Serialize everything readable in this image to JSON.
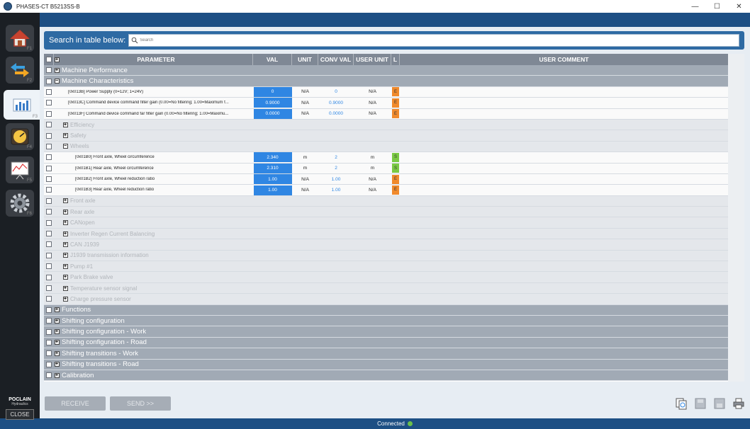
{
  "window": {
    "title": "PHASES-CT B5213SS-B",
    "minimize": "—",
    "maximize": "☐",
    "close": "✕"
  },
  "sidebar": {
    "items": [
      {
        "icon": "home-icon",
        "num": "F1"
      },
      {
        "icon": "transfer-arrows-icon",
        "num": "F2"
      },
      {
        "icon": "parameters-chart-icon",
        "num": "F3"
      },
      {
        "icon": "gauge-icon",
        "num": "F4"
      },
      {
        "icon": "trend-chart-icon",
        "num": "F5"
      },
      {
        "icon": "gear-icon",
        "num": "F6"
      }
    ],
    "brand": "POCLAIN",
    "brand_sub": "Hydraulics",
    "close_label": "CLOSE"
  },
  "search": {
    "label": "Search in table below:",
    "placeholder": "Search"
  },
  "table": {
    "headers": {
      "parameter": "PARAMETER",
      "val": "VAL",
      "unit": "UNIT",
      "conv_val": "CONV VAL",
      "user_unit": "USER UNIT",
      "l": "L",
      "user_comment": "USER COMMENT"
    },
    "rows": [
      {
        "kind": "group",
        "label": "Machine Performance",
        "expand": "+"
      },
      {
        "kind": "group",
        "label": "Machine Characteristics",
        "expand": "−"
      },
      {
        "kind": "param",
        "indent": 1,
        "label": "[0x013B] Power Supply  (0=12V; 1=24V)",
        "val": "0",
        "unit": "N/A",
        "conv": "0",
        "uunit": "N/A",
        "l": "E"
      },
      {
        "kind": "param",
        "indent": 1,
        "label": "[0x013C] Command device command filter gain (0.00=No filtering; 1.00=Maximum f...",
        "val": "0.9000",
        "unit": "N/A",
        "conv": "0.9000",
        "uunit": "N/A",
        "l": "E"
      },
      {
        "kind": "param",
        "indent": 1,
        "label": "[0x013F] Command device command far filter gain (0.00=No filtering; 1.00=Maximu...",
        "val": "0.0000",
        "unit": "N/A",
        "conv": "0.0000",
        "uunit": "N/A",
        "l": "E"
      },
      {
        "kind": "sub",
        "label": "Efficiency",
        "expand": "+"
      },
      {
        "kind": "sub",
        "label": "Safety",
        "expand": "+"
      },
      {
        "kind": "sub",
        "label": "Wheels",
        "expand": "−"
      },
      {
        "kind": "param",
        "indent": 2,
        "label": "[0x01B0] Front axle, Wheel circumference",
        "val": "2.340",
        "unit": "m",
        "conv": "2",
        "uunit": "m",
        "l": "S"
      },
      {
        "kind": "param",
        "indent": 2,
        "label": "[0x01B1] Rear axle, Wheel circumference",
        "val": "2.310",
        "unit": "m",
        "conv": "2",
        "uunit": "m",
        "l": "S"
      },
      {
        "kind": "param",
        "indent": 2,
        "label": "[0x01B2] Front axle, Wheel reduction ratio",
        "val": "1.00",
        "unit": "N/A",
        "conv": "1.00",
        "uunit": "N/A",
        "l": "E"
      },
      {
        "kind": "param",
        "indent": 2,
        "label": "[0x01B3] Rear axle, Wheel reduction ratio",
        "val": "1.00",
        "unit": "N/A",
        "conv": "1.00",
        "uunit": "N/A",
        "l": "E"
      },
      {
        "kind": "sub",
        "label": "Front axle",
        "expand": "+"
      },
      {
        "kind": "sub",
        "label": "Rear axle",
        "expand": "+"
      },
      {
        "kind": "sub",
        "label": "CANopen",
        "expand": "+"
      },
      {
        "kind": "sub",
        "label": "Inverter Regen Current Balancing",
        "expand": "+"
      },
      {
        "kind": "sub",
        "label": "CAN J1939",
        "expand": "+"
      },
      {
        "kind": "sub",
        "label": "J1939 transmission information",
        "expand": "+"
      },
      {
        "kind": "sub",
        "label": "Pump #1",
        "expand": "+"
      },
      {
        "kind": "sub",
        "label": "Park Brake valve",
        "expand": "+"
      },
      {
        "kind": "sub",
        "label": "Temperature sensor signal",
        "expand": "+"
      },
      {
        "kind": "sub",
        "label": "Charge pressure sensor",
        "expand": "+"
      },
      {
        "kind": "group",
        "label": "Functions",
        "expand": "+"
      },
      {
        "kind": "group",
        "label": "Shifting configuration",
        "expand": "+"
      },
      {
        "kind": "group",
        "label": "Shifting configuration - Work",
        "expand": "+"
      },
      {
        "kind": "group",
        "label": "Shifting configuration - Road",
        "expand": "+"
      },
      {
        "kind": "group",
        "label": "Shifting transitions - Work",
        "expand": "+"
      },
      {
        "kind": "group",
        "label": "Shifting transitions - Road",
        "expand": "+"
      },
      {
        "kind": "group",
        "label": "Calibration",
        "expand": "+"
      }
    ]
  },
  "buttons": {
    "receive": "RECEIVE",
    "send": "SEND >>"
  },
  "status": {
    "text": "Connected",
    "color": "#6bc04b"
  },
  "colors": {
    "accent": "#2f86e3",
    "level_e": "#f08a2c",
    "level_s": "#7ac943"
  }
}
